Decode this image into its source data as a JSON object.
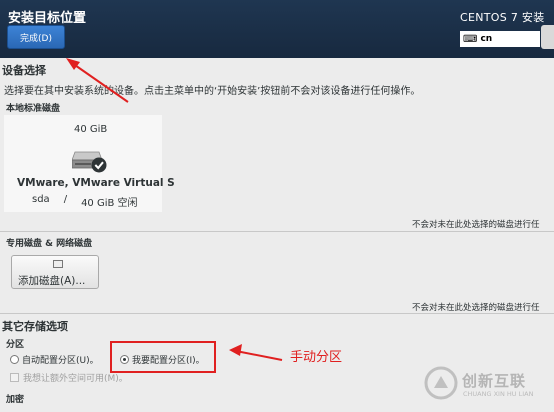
{
  "header": {
    "title": "安装目标位置",
    "done_button": "完成(D)",
    "product": "CENTOS 7 安装",
    "keyboard": "cn"
  },
  "device_selection": {
    "title": "设备选择",
    "description": "选择要在其中安装系统的设备。点击主菜单中的‘开始安装’按钮前不会对该设备进行任何操作。",
    "local_disks_label": "本地标准磁盘",
    "disk": {
      "size": "40 GiB",
      "name": "VMware, VMware Virtual S",
      "device": "sda",
      "separator": "/",
      "free": "40 GiB 空闲"
    },
    "local_note": "不会对未在此处选择的磁盘进行任",
    "special_label": "专用磁盘 & 网络磁盘",
    "add_disk_button": "添加磁盘(A)...",
    "special_note": "不会对未在此处选择的磁盘进行任"
  },
  "other_storage": {
    "title": "其它存储选项",
    "partitioning_label": "分区",
    "auto_option": "自动配置分区(U)。",
    "manual_option": "我要配置分区(I)。",
    "extra_space_option": "我想让额外空间可用(M)。",
    "encryption_label": "加密"
  },
  "annotation": {
    "text": "手动分区",
    "color": "#e02020"
  },
  "watermark": {
    "text": "创新互联",
    "sub": "CHUANG XIN HU LIAN"
  }
}
